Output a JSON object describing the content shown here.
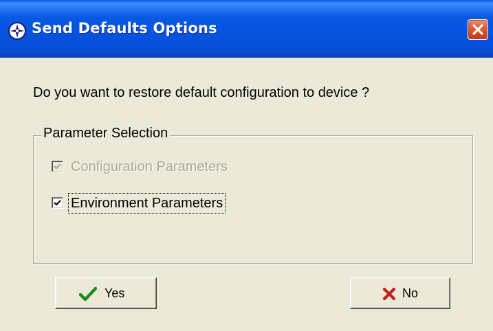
{
  "window": {
    "title": "Send Defaults Options",
    "icons": {
      "app": "compass-app-icon",
      "close": "close-icon"
    },
    "colors": {
      "titlebar": "#0553DF",
      "close_button": "#D4491F",
      "background": "#ECE9D8",
      "disabled_text": "#ACA899"
    }
  },
  "dialog": {
    "question": "Do you want to restore default configuration to device ?"
  },
  "parameter_selection": {
    "legend": "Parameter Selection",
    "options": [
      {
        "label": "Configuration Parameters",
        "checked": true,
        "enabled": false
      },
      {
        "label": "Environment Parameters",
        "checked": true,
        "enabled": true,
        "focused": true
      }
    ]
  },
  "buttons": {
    "yes_label": "Yes",
    "yes_icon": "checkmark-icon",
    "no_label": "No",
    "no_icon": "x-mark-icon"
  }
}
